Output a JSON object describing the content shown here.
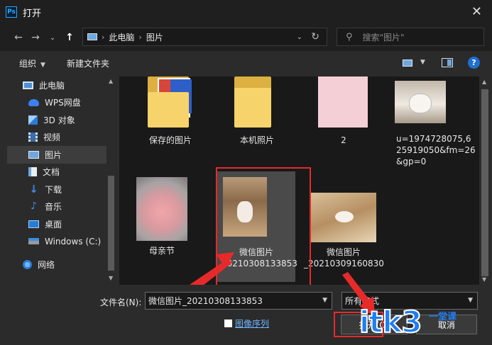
{
  "window": {
    "title": "打开",
    "app_icon_text": "Ps",
    "close": "✕"
  },
  "nav": {
    "back": "←",
    "forward": "→",
    "history": "⌄",
    "up": "↑",
    "breadcrumb": [
      "此电脑",
      "图片"
    ],
    "search_placeholder": "搜索\"图片\""
  },
  "toolbar": {
    "organize": "组织",
    "new_folder": "新建文件夹",
    "help": "?"
  },
  "sidebar": {
    "items": [
      {
        "label": "此电脑",
        "icon": "computer-icon"
      },
      {
        "label": "WPS网盘",
        "icon": "cloud-icon"
      },
      {
        "label": "3D 对象",
        "icon": "cube-icon"
      },
      {
        "label": "视频",
        "icon": "video-icon"
      },
      {
        "label": "图片",
        "icon": "pictures-icon",
        "selected": true
      },
      {
        "label": "文档",
        "icon": "documents-icon"
      },
      {
        "label": "下载",
        "icon": "download-icon"
      },
      {
        "label": "音乐",
        "icon": "music-icon"
      },
      {
        "label": "桌面",
        "icon": "desktop-icon"
      },
      {
        "label": "Windows (C:)",
        "icon": "drive-icon"
      },
      {
        "label": "网络",
        "icon": "network-icon"
      }
    ]
  },
  "files": [
    {
      "label": "保存的图片",
      "kind": "folder"
    },
    {
      "label": "本机照片",
      "kind": "folder"
    },
    {
      "label": "2",
      "kind": "image"
    },
    {
      "label": "u=1974728075,625919050&fm=26&gp=0",
      "kind": "image"
    },
    {
      "label": "母亲节",
      "kind": "image"
    },
    {
      "label": "微信图片_20210308133853",
      "kind": "image",
      "selected": true
    },
    {
      "label": "微信图片_20210309160830",
      "kind": "image"
    }
  ],
  "bottom": {
    "filename_label": "文件名(N):",
    "filename_value": "微信图片_20210308133853",
    "filetype_value": "所有格式",
    "sequence_label": "图像序列",
    "open_label": "打开(O)",
    "cancel_label": "取消"
  },
  "watermark": {
    "text": "itk3",
    "suffix": "一堂课"
  },
  "colors": {
    "accent": "#31a8ff",
    "highlight_red": "#e62a2a",
    "folder": "#f6d36b"
  }
}
